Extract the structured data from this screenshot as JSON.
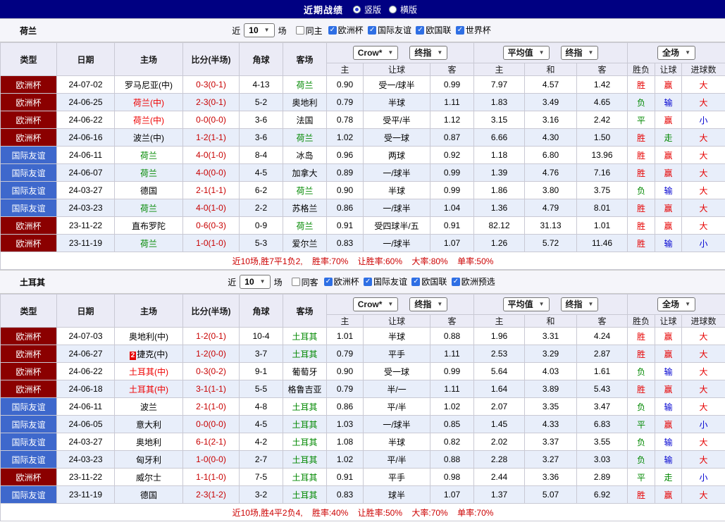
{
  "topbar": {
    "title": "近期战绩",
    "radios": [
      {
        "label": "竖版",
        "checked": true
      },
      {
        "label": "横版",
        "checked": false
      }
    ]
  },
  "colors": {
    "euro_cup_bg": "#8B0000",
    "friendly_bg": "#3e68cc",
    "win_red": "#e60000",
    "draw_loss_green": "#008800",
    "lose_blue": "#0000d0",
    "score_red": "#c80000",
    "topbar_bg": "#000082"
  },
  "sections": [
    {
      "team": "荷兰",
      "filter": {
        "near": "近",
        "count": "10",
        "unit": "场",
        "same_label": "同主",
        "same_checked": false,
        "leagues": [
          {
            "label": "欧洲杯",
            "checked": true
          },
          {
            "label": "国际友谊",
            "checked": true
          },
          {
            "label": "欧国联",
            "checked": true
          },
          {
            "label": "世界杯",
            "checked": true
          }
        ]
      },
      "header": {
        "type": "类型",
        "date": "日期",
        "home": "主场",
        "score": "比分(半场)",
        "corner": "角球",
        "away": "客场",
        "dd_bookmaker": "Crow*",
        "dd_final_a": "终指",
        "dd_average": "平均值",
        "dd_final_b": "终指",
        "dd_scope": "全场",
        "sub": [
          "主",
          "让球",
          "客",
          "主",
          "和",
          "客",
          "胜负",
          "让球",
          "进球数"
        ]
      },
      "rows": [
        {
          "type": "欧洲杯",
          "type_class": "t-cup",
          "date": "24-07-02",
          "badge": "",
          "badge_class": "",
          "home": "罗马尼亚(中)",
          "home_class": "",
          "score": "0-3(0-1)",
          "corner": "4-13",
          "away": "荷兰",
          "away_class": "t-green",
          "o1": "0.90",
          "line": "受一/球半",
          "o2": "0.99",
          "a1": "7.97",
          "a2": "4.57",
          "a3": "1.42",
          "r1": "胜",
          "r1_class": "c-red",
          "r2": "赢",
          "r2_class": "c-red",
          "r3": "大",
          "r3_class": "c-red"
        },
        {
          "type": "欧洲杯",
          "type_class": "t-cup",
          "date": "24-06-25",
          "badge": "",
          "badge_class": "",
          "home": "荷兰(中)",
          "home_class": "t-red",
          "score": "2-3(0-1)",
          "corner": "5-2",
          "away": "奥地利",
          "away_class": "",
          "o1": "0.79",
          "line": "半球",
          "o2": "1.11",
          "a1": "1.83",
          "a2": "3.49",
          "a3": "4.65",
          "r1": "负",
          "r1_class": "c-green",
          "r2": "输",
          "r2_class": "c-blue",
          "r3": "大",
          "r3_class": "c-red"
        },
        {
          "type": "欧洲杯",
          "type_class": "t-cup",
          "date": "24-06-22",
          "badge": "",
          "badge_class": "",
          "home": "荷兰(中)",
          "home_class": "t-red",
          "score": "0-0(0-0)",
          "corner": "3-6",
          "away": "法国",
          "away_class": "",
          "o1": "0.78",
          "line": "受平/半",
          "o2": "1.12",
          "a1": "3.15",
          "a2": "3.16",
          "a3": "2.42",
          "r1": "平",
          "r1_class": "c-green",
          "r2": "赢",
          "r2_class": "c-red",
          "r3": "小",
          "r3_class": "c-blue"
        },
        {
          "type": "欧洲杯",
          "type_class": "t-cup",
          "date": "24-06-16",
          "badge": "",
          "badge_class": "",
          "home": "波兰(中)",
          "home_class": "",
          "score": "1-2(1-1)",
          "corner": "3-6",
          "away": "荷兰",
          "away_class": "t-green",
          "o1": "1.02",
          "line": "受一球",
          "o2": "0.87",
          "a1": "6.66",
          "a2": "4.30",
          "a3": "1.50",
          "r1": "胜",
          "r1_class": "c-red",
          "r2": "走",
          "r2_class": "c-green",
          "r3": "大",
          "r3_class": "c-red"
        },
        {
          "type": "国际友谊",
          "type_class": "t-friendly",
          "date": "24-06-11",
          "badge": "",
          "badge_class": "",
          "home": "荷兰",
          "home_class": "t-green",
          "score": "4-0(1-0)",
          "corner": "8-4",
          "away": "冰岛",
          "away_class": "",
          "o1": "0.96",
          "line": "两球",
          "o2": "0.92",
          "a1": "1.18",
          "a2": "6.80",
          "a3": "13.96",
          "r1": "胜",
          "r1_class": "c-red",
          "r2": "赢",
          "r2_class": "c-red",
          "r3": "大",
          "r3_class": "c-red"
        },
        {
          "type": "国际友谊",
          "type_class": "t-friendly",
          "date": "24-06-07",
          "badge": "",
          "badge_class": "",
          "home": "荷兰",
          "home_class": "t-green",
          "score": "4-0(0-0)",
          "corner": "4-5",
          "away": "加拿大",
          "away_class": "",
          "o1": "0.89",
          "line": "一/球半",
          "o2": "0.99",
          "a1": "1.39",
          "a2": "4.76",
          "a3": "7.16",
          "r1": "胜",
          "r1_class": "c-red",
          "r2": "赢",
          "r2_class": "c-red",
          "r3": "大",
          "r3_class": "c-red"
        },
        {
          "type": "国际友谊",
          "type_class": "t-friendly",
          "date": "24-03-27",
          "badge": "",
          "badge_class": "",
          "home": "德国",
          "home_class": "",
          "score": "2-1(1-1)",
          "corner": "6-2",
          "away": "荷兰",
          "away_class": "t-green",
          "o1": "0.90",
          "line": "半球",
          "o2": "0.99",
          "a1": "1.86",
          "a2": "3.80",
          "a3": "3.75",
          "r1": "负",
          "r1_class": "c-green",
          "r2": "输",
          "r2_class": "c-blue",
          "r3": "大",
          "r3_class": "c-red"
        },
        {
          "type": "国际友谊",
          "type_class": "t-friendly",
          "date": "24-03-23",
          "badge": "",
          "badge_class": "",
          "home": "荷兰",
          "home_class": "t-green",
          "score": "4-0(1-0)",
          "corner": "2-2",
          "away": "苏格兰",
          "away_class": "",
          "o1": "0.86",
          "line": "一/球半",
          "o2": "1.04",
          "a1": "1.36",
          "a2": "4.79",
          "a3": "8.01",
          "r1": "胜",
          "r1_class": "c-red",
          "r2": "赢",
          "r2_class": "c-red",
          "r3": "大",
          "r3_class": "c-red"
        },
        {
          "type": "欧洲杯",
          "type_class": "t-cup",
          "date": "23-11-22",
          "badge": "",
          "badge_class": "",
          "home": "直布罗陀",
          "home_class": "",
          "score": "0-6(0-3)",
          "corner": "0-9",
          "away": "荷兰",
          "away_class": "t-green",
          "o1": "0.91",
          "line": "受四球半/五",
          "o2": "0.91",
          "a1": "82.12",
          "a2": "31.13",
          "a3": "1.01",
          "r1": "胜",
          "r1_class": "c-red",
          "r2": "赢",
          "r2_class": "c-red",
          "r3": "大",
          "r3_class": "c-red"
        },
        {
          "type": "欧洲杯",
          "type_class": "t-cup",
          "date": "23-11-19",
          "badge": "",
          "badge_class": "",
          "home": "荷兰",
          "home_class": "t-green",
          "score": "1-0(1-0)",
          "corner": "5-3",
          "away": "爱尔兰",
          "away_class": "",
          "o1": "0.83",
          "line": "一/球半",
          "o2": "1.07",
          "a1": "1.26",
          "a2": "5.72",
          "a3": "11.46",
          "r1": "胜",
          "r1_class": "c-red",
          "r2": "输",
          "r2_class": "c-blue",
          "r3": "小",
          "r3_class": "c-blue"
        }
      ],
      "footer": {
        "record": "近10场,胜7平1负2,",
        "win_rate": "胜率:70%",
        "handicap_rate": "让胜率:60%",
        "over_rate": "大率:80%",
        "single_rate": "单率:50%"
      }
    },
    {
      "team": "土耳其",
      "filter": {
        "near": "近",
        "count": "10",
        "unit": "场",
        "same_label": "同客",
        "same_checked": false,
        "leagues": [
          {
            "label": "欧洲杯",
            "checked": true
          },
          {
            "label": "国际友谊",
            "checked": true
          },
          {
            "label": "欧国联",
            "checked": true
          },
          {
            "label": "欧洲预选",
            "checked": true
          }
        ]
      },
      "header": {
        "type": "类型",
        "date": "日期",
        "home": "主场",
        "score": "比分(半场)",
        "corner": "角球",
        "away": "客场",
        "dd_bookmaker": "Crow*",
        "dd_final_a": "终指",
        "dd_average": "平均值",
        "dd_final_b": "终指",
        "dd_scope": "全场",
        "sub": [
          "主",
          "让球",
          "客",
          "主",
          "和",
          "客",
          "胜负",
          "让球",
          "进球数"
        ]
      },
      "rows": [
        {
          "type": "欧洲杯",
          "type_class": "t-cup",
          "date": "24-07-03",
          "badge": "",
          "badge_class": "",
          "home": "奥地利(中)",
          "home_class": "",
          "score": "1-2(0-1)",
          "corner": "10-4",
          "away": "土耳其",
          "away_class": "t-green",
          "o1": "1.01",
          "line": "半球",
          "o2": "0.88",
          "a1": "1.96",
          "a2": "3.31",
          "a3": "4.24",
          "r1": "胜",
          "r1_class": "c-red",
          "r2": "赢",
          "r2_class": "c-red",
          "r3": "大",
          "r3_class": "c-red"
        },
        {
          "type": "欧洲杯",
          "type_class": "t-cup",
          "date": "24-06-27",
          "badge": "2",
          "badge_class": "redcard",
          "home": "捷克(中)",
          "home_class": "",
          "score": "1-2(0-0)",
          "corner": "3-7",
          "away": "土耳其",
          "away_class": "t-green",
          "o1": "0.79",
          "line": "平手",
          "o2": "1.11",
          "a1": "2.53",
          "a2": "3.29",
          "a3": "2.87",
          "r1": "胜",
          "r1_class": "c-red",
          "r2": "赢",
          "r2_class": "c-red",
          "r3": "大",
          "r3_class": "c-red"
        },
        {
          "type": "欧洲杯",
          "type_class": "t-cup",
          "date": "24-06-22",
          "badge": "",
          "badge_class": "",
          "home": "土耳其(中)",
          "home_class": "t-red",
          "score": "0-3(0-2)",
          "corner": "9-1",
          "away": "葡萄牙",
          "away_class": "",
          "o1": "0.90",
          "line": "受一球",
          "o2": "0.99",
          "a1": "5.64",
          "a2": "4.03",
          "a3": "1.61",
          "r1": "负",
          "r1_class": "c-green",
          "r2": "输",
          "r2_class": "c-blue",
          "r3": "大",
          "r3_class": "c-red"
        },
        {
          "type": "欧洲杯",
          "type_class": "t-cup",
          "date": "24-06-18",
          "badge": "",
          "badge_class": "",
          "home": "土耳其(中)",
          "home_class": "t-red",
          "score": "3-1(1-1)",
          "corner": "5-5",
          "away": "格鲁吉亚",
          "away_class": "",
          "o1": "0.79",
          "line": "半/一",
          "o2": "1.11",
          "a1": "1.64",
          "a2": "3.89",
          "a3": "5.43",
          "r1": "胜",
          "r1_class": "c-red",
          "r2": "赢",
          "r2_class": "c-red",
          "r3": "大",
          "r3_class": "c-red"
        },
        {
          "type": "国际友谊",
          "type_class": "t-friendly",
          "date": "24-06-11",
          "badge": "",
          "badge_class": "",
          "home": "波兰",
          "home_class": "",
          "score": "2-1(1-0)",
          "corner": "4-8",
          "away": "土耳其",
          "away_class": "t-green",
          "o1": "0.86",
          "line": "平/半",
          "o2": "1.02",
          "a1": "2.07",
          "a2": "3.35",
          "a3": "3.47",
          "r1": "负",
          "r1_class": "c-green",
          "r2": "输",
          "r2_class": "c-blue",
          "r3": "大",
          "r3_class": "c-red"
        },
        {
          "type": "国际友谊",
          "type_class": "t-friendly",
          "date": "24-06-05",
          "badge": "",
          "badge_class": "",
          "home": "意大利",
          "home_class": "",
          "score": "0-0(0-0)",
          "corner": "4-5",
          "away": "土耳其",
          "away_class": "t-green",
          "o1": "1.03",
          "line": "一/球半",
          "o2": "0.85",
          "a1": "1.45",
          "a2": "4.33",
          "a3": "6.83",
          "r1": "平",
          "r1_class": "c-green",
          "r2": "赢",
          "r2_class": "c-red",
          "r3": "小",
          "r3_class": "c-blue"
        },
        {
          "type": "国际友谊",
          "type_class": "t-friendly",
          "date": "24-03-27",
          "badge": "",
          "badge_class": "",
          "home": "奥地利",
          "home_class": "",
          "score": "6-1(2-1)",
          "corner": "4-2",
          "away": "土耳其",
          "away_class": "t-green",
          "o1": "1.08",
          "line": "半球",
          "o2": "0.82",
          "a1": "2.02",
          "a2": "3.37",
          "a3": "3.55",
          "r1": "负",
          "r1_class": "c-green",
          "r2": "输",
          "r2_class": "c-blue",
          "r3": "大",
          "r3_class": "c-red"
        },
        {
          "type": "国际友谊",
          "type_class": "t-friendly",
          "date": "24-03-23",
          "badge": "",
          "badge_class": "",
          "home": "匈牙利",
          "home_class": "",
          "score": "1-0(0-0)",
          "corner": "2-7",
          "away": "土耳其",
          "away_class": "t-green",
          "o1": "1.02",
          "line": "平/半",
          "o2": "0.88",
          "a1": "2.28",
          "a2": "3.27",
          "a3": "3.03",
          "r1": "负",
          "r1_class": "c-green",
          "r2": "输",
          "r2_class": "c-blue",
          "r3": "大",
          "r3_class": "c-red"
        },
        {
          "type": "欧洲杯",
          "type_class": "t-cup",
          "date": "23-11-22",
          "badge": "",
          "badge_class": "",
          "home": "威尔士",
          "home_class": "",
          "score": "1-1(1-0)",
          "corner": "7-5",
          "away": "土耳其",
          "away_class": "t-green",
          "o1": "0.91",
          "line": "平手",
          "o2": "0.98",
          "a1": "2.44",
          "a2": "3.36",
          "a3": "2.89",
          "r1": "平",
          "r1_class": "c-green",
          "r2": "走",
          "r2_class": "c-green",
          "r3": "小",
          "r3_class": "c-blue"
        },
        {
          "type": "国际友谊",
          "type_class": "t-friendly",
          "date": "23-11-19",
          "badge": "",
          "badge_class": "",
          "home": "德国",
          "home_class": "",
          "score": "2-3(1-2)",
          "corner": "3-2",
          "away": "土耳其",
          "away_class": "t-green",
          "o1": "0.83",
          "line": "球半",
          "o2": "1.07",
          "a1": "1.37",
          "a2": "5.07",
          "a3": "6.92",
          "r1": "胜",
          "r1_class": "c-red",
          "r2": "赢",
          "r2_class": "c-red",
          "r3": "大",
          "r3_class": "c-red"
        }
      ],
      "footer": {
        "record": "近10场,胜4平2负4,",
        "win_rate": "胜率:40%",
        "handicap_rate": "让胜率:50%",
        "over_rate": "大率:70%",
        "single_rate": "单率:70%"
      }
    }
  ]
}
